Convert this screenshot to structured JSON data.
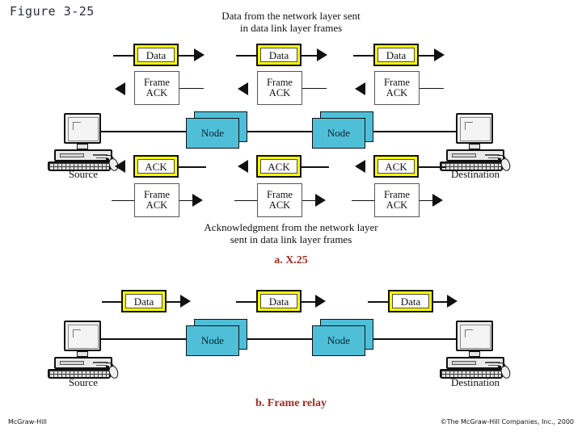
{
  "figure": {
    "title": "Figure 3-25"
  },
  "footer": {
    "left": "McGraw-Hill",
    "right": "©The McGraw-Hill Companies, Inc., 2000"
  },
  "colors": {
    "packet_highlight": "#ffff00",
    "node_fill": "#4fbfd8",
    "part_label": "#a02c22",
    "line": "#111111"
  },
  "part_a": {
    "label": "a. X.25",
    "top_caption_line1": "Data from the network layer sent",
    "top_caption_line2": "in data link layer frames",
    "bottom_caption_line1": "Acknowledgment from the network layer",
    "bottom_caption_line2": "sent in data link layer frames",
    "source_label": "Source",
    "destination_label": "Destination",
    "nodes": [
      {
        "label": "Node"
      },
      {
        "label": "Node"
      }
    ],
    "data_row": [
      {
        "label": "Data",
        "direction": "right"
      },
      {
        "label": "Data",
        "direction": "right"
      },
      {
        "label": "Data",
        "direction": "right"
      }
    ],
    "frame_ack_row_upper": [
      {
        "line1": "Frame",
        "line2": "ACK",
        "direction": "left"
      },
      {
        "line1": "Frame",
        "line2": "ACK",
        "direction": "left"
      },
      {
        "line1": "Frame",
        "line2": "ACK",
        "direction": "left"
      }
    ],
    "ack_row": [
      {
        "label": "ACK",
        "direction": "left"
      },
      {
        "label": "ACK",
        "direction": "left"
      },
      {
        "label": "ACK",
        "direction": "left"
      }
    ],
    "frame_ack_row_lower": [
      {
        "line1": "Frame",
        "line2": "ACK",
        "direction": "right"
      },
      {
        "line1": "Frame",
        "line2": "ACK",
        "direction": "right"
      },
      {
        "line1": "Frame",
        "line2": "ACK",
        "direction": "right"
      }
    ]
  },
  "part_b": {
    "label": "b. Frame relay",
    "source_label": "Source",
    "destination_label": "Destination",
    "nodes": [
      {
        "label": "Node"
      },
      {
        "label": "Node"
      }
    ],
    "data_row": [
      {
        "label": "Data",
        "direction": "right"
      },
      {
        "label": "Data",
        "direction": "right"
      },
      {
        "label": "Data",
        "direction": "right"
      }
    ]
  }
}
